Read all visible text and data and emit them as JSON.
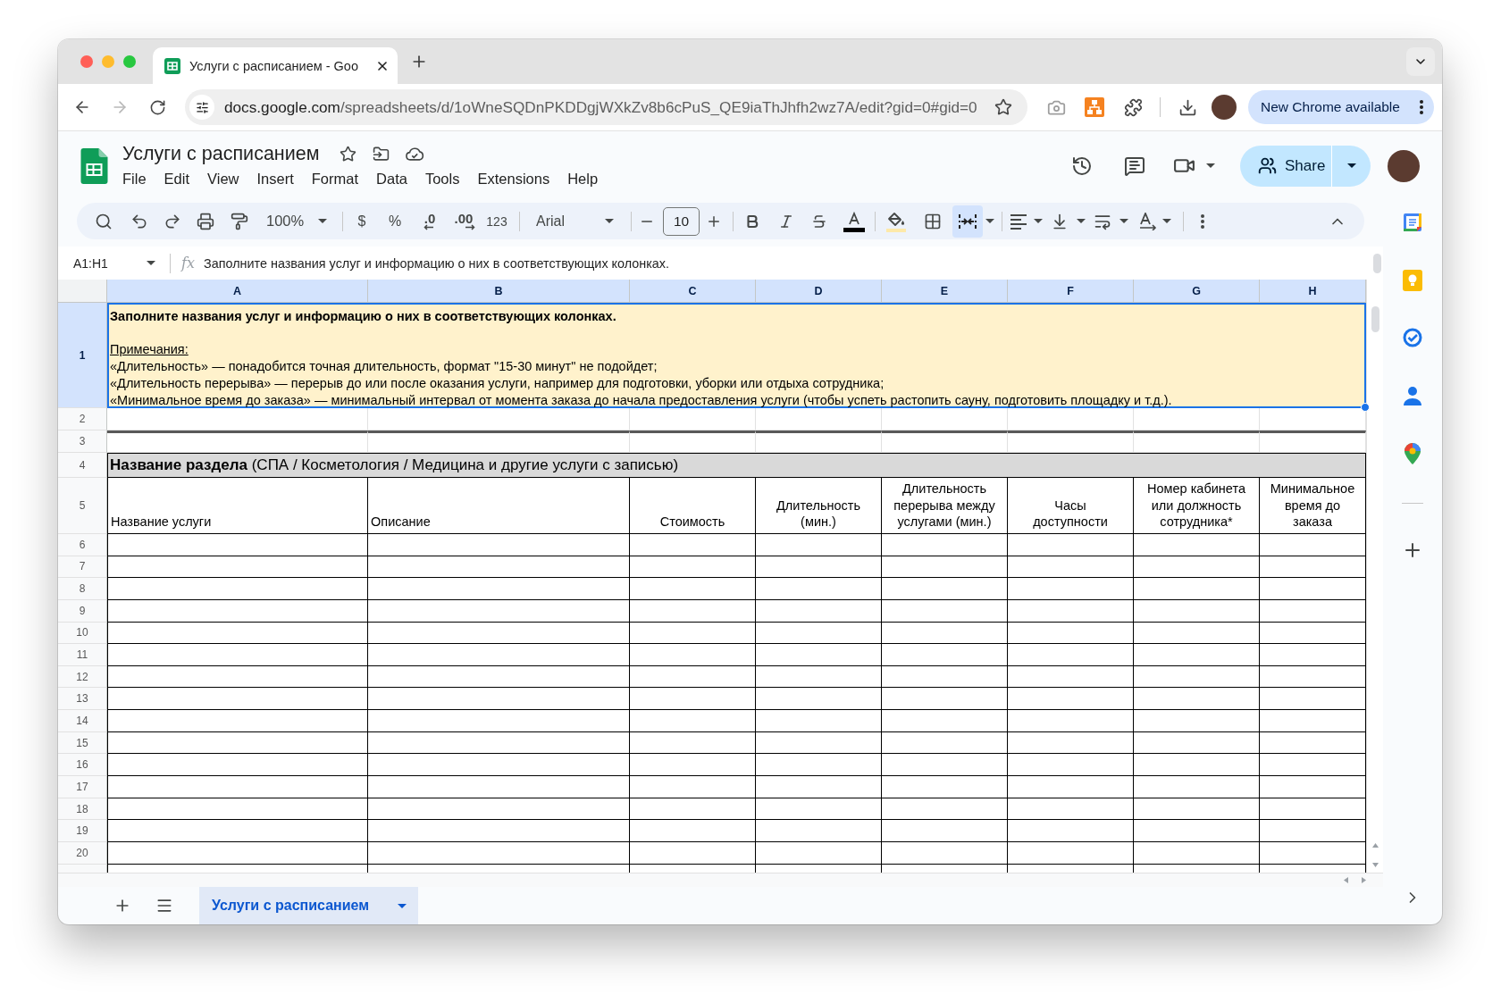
{
  "browser": {
    "tab_title": "Услуги с расписанием - Goo",
    "forward_disabled": true,
    "url_host": "docs.google.com",
    "url_path": "/spreadsheets/d/1oWneSQDnPKDDgjWXkZv8b6cPuS_QE9iaThJhfh2wz7A/edit?gid=0#gid=0",
    "update_button": "New Chrome available"
  },
  "document": {
    "title": "Услуги с расписанием",
    "menu": [
      "File",
      "Edit",
      "View",
      "Insert",
      "Format",
      "Data",
      "Tools",
      "Extensions",
      "Help"
    ],
    "share_button": "Share"
  },
  "toolbar": {
    "zoom": "100%",
    "currency": "$",
    "percent": "%",
    "decrease_decimals": ".0",
    "increase_decimals": ".00",
    "number_format": "123",
    "font": "Arial",
    "font_size": "10",
    "merge_cells": {
      "selected": true
    }
  },
  "formula_bar": {
    "name_box": "A1:H1",
    "function_label": "fx",
    "value": "Заполните названия услуг и информацию о них в соответствующих колонках."
  },
  "grid": {
    "columns": [
      {
        "label": "A",
        "selected": true
      },
      {
        "label": "B",
        "selected": true
      },
      {
        "label": "C",
        "selected": true
      },
      {
        "label": "D",
        "selected": true
      },
      {
        "label": "E",
        "selected": true
      },
      {
        "label": "F",
        "selected": true
      },
      {
        "label": "G",
        "selected": true
      },
      {
        "label": "H",
        "selected": true
      }
    ],
    "rows": [
      {
        "number": "1",
        "selected": true,
        "kind": "note",
        "lines": [
          {
            "kind": "title",
            "text": "Заполните названия услуг и информацию о них в соответствующих колонках."
          },
          {
            "kind": "label",
            "text": "Примечания:"
          },
          {
            "kind": "text",
            "text": "«Длительность» — понадобится точная длительность, формат \"15-30 минут\" не подойдет;"
          },
          {
            "kind": "text",
            "text": "«Длительность перерыва» — перерыв до или после оказания услуги, например для подготовки, уборки или отдыха сотрудника;"
          },
          {
            "kind": "text",
            "text": "«Минимальное время до заказа» — минимальный интервал от момента заказа до начала предоставления услуги (чтобы успеть растопить сауну, подготовить площадку и т.д.)."
          }
        ]
      },
      {
        "number": "2",
        "selected": false,
        "kind": "empty"
      },
      {
        "number": "3",
        "selected": false,
        "kind": "rule"
      },
      {
        "number": "4",
        "selected": false,
        "kind": "section",
        "text": "**Название раздела** (СПА / Косметология / Медицина и другие услуги с записью)"
      },
      {
        "number": "5",
        "selected": false,
        "kind": "header",
        "cells": [
          "Название услуги",
          "Описание",
          "Стоимость",
          "Длительность\n(мин.)",
          "Длительность\nперерыва между\nуслугами (мин.)",
          "Часы\nдоступности",
          "Номер кабинета\nили должность\nсотрудника*",
          "Минимальное\nвремя до\nзаказа"
        ]
      },
      {
        "number": "6",
        "selected": false,
        "kind": "table"
      },
      {
        "number": "7",
        "selected": false,
        "kind": "table"
      },
      {
        "number": "8",
        "selected": false,
        "kind": "table"
      },
      {
        "number": "9",
        "selected": false,
        "kind": "table"
      },
      {
        "number": "10",
        "selected": false,
        "kind": "table"
      },
      {
        "number": "11",
        "selected": false,
        "kind": "table"
      },
      {
        "number": "12",
        "selected": false,
        "kind": "table"
      },
      {
        "number": "13",
        "selected": false,
        "kind": "table"
      },
      {
        "number": "14",
        "selected": false,
        "kind": "table"
      },
      {
        "number": "15",
        "selected": false,
        "kind": "table"
      },
      {
        "number": "16",
        "selected": false,
        "kind": "table"
      },
      {
        "number": "17",
        "selected": false,
        "kind": "table"
      },
      {
        "number": "18",
        "selected": false,
        "kind": "table"
      },
      {
        "number": "19",
        "selected": false,
        "kind": "table"
      },
      {
        "number": "20",
        "selected": false,
        "kind": "table"
      }
    ]
  },
  "sheet_tabs": [
    {
      "label": "Услуги с расписанием",
      "selected": true
    }
  ]
}
